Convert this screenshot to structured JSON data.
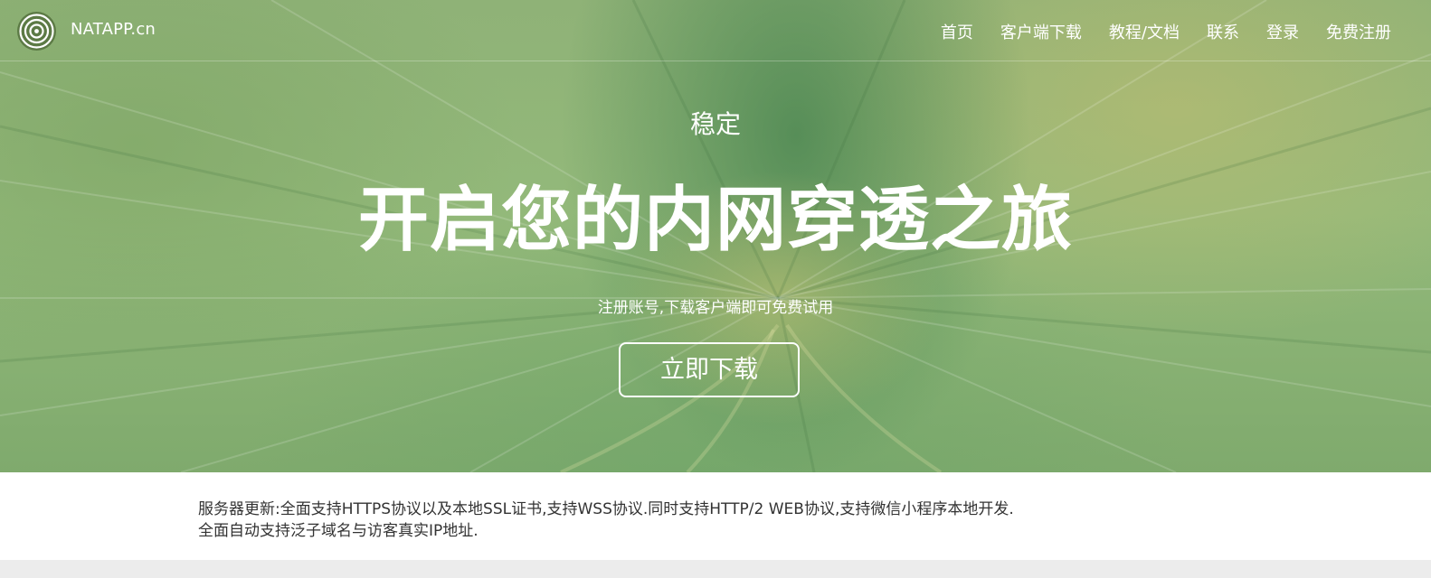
{
  "brand": {
    "name": "NATAPP.cn"
  },
  "nav": {
    "items": [
      {
        "label": "首页"
      },
      {
        "label": "客户端下载"
      },
      {
        "label": "教程/文档"
      },
      {
        "label": "联系"
      },
      {
        "label": "登录"
      },
      {
        "label": "免费注册"
      }
    ]
  },
  "hero": {
    "eyebrow": "稳定",
    "headline": "开启您的内网穿透之旅",
    "subline": "注册账号,下载客户端即可免费试用",
    "cta_label": "立即下载"
  },
  "notice": {
    "line1": "服务器更新:全面支持HTTPS协议以及本地SSL证书,支持WSS协议.同时支持HTTP/2 WEB协议,支持微信小程序本地开发.",
    "line2": "全面自动支持泛子域名与访客真实IP地址."
  },
  "colors": {
    "hero_tint": "#8fb277",
    "text_on_hero": "#ffffff",
    "notice_text": "#333333",
    "footer_band": "#ececec"
  },
  "icons": {
    "logo": "concentric-rings-logo-icon"
  }
}
